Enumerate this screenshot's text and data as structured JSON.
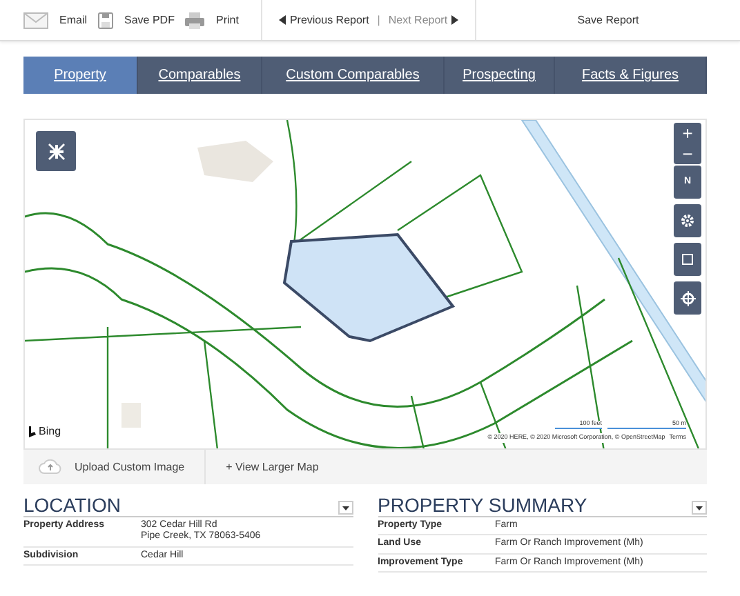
{
  "toolbar": {
    "actions": [
      {
        "label": "Email",
        "kind": "email"
      },
      {
        "label": "Save PDF",
        "kind": "pdf"
      },
      {
        "label": "Print",
        "kind": "print"
      }
    ],
    "previous": {
      "label": "Previous Report",
      "disabled": false
    },
    "next": {
      "label": "Next Report",
      "disabled": true
    },
    "separator": "|",
    "save": "Save Report"
  },
  "tabs": [
    {
      "label": "Property",
      "selected": true
    },
    {
      "label": "Comparables",
      "selected": false
    },
    {
      "label": "Custom Comparables",
      "selected": false
    },
    {
      "label": "Prospecting",
      "selected": false
    },
    {
      "label": "Facts & Figures",
      "selected": false
    }
  ],
  "map": {
    "kind": "picture",
    "controls": [
      {
        "kind": "zoom-in",
        "label": "+"
      },
      {
        "kind": "zoom-out",
        "label": "−"
      },
      {
        "kind": "compass",
        "label": "N"
      },
      {
        "kind": "settings"
      },
      {
        "kind": "select"
      },
      {
        "kind": "locate"
      }
    ],
    "brand": "Bing",
    "scale_feet": "100 feet",
    "scale_meters": "50 m",
    "attribution": "© 2020 HERE, © 2020 Microsoft Corporation, © OpenStreetMap",
    "terms": "Terms",
    "upload": "Upload Custom Image",
    "larger": "+ View Larger Map"
  },
  "sections": [
    {
      "title": "LOCATION",
      "rows": [
        {
          "label": "Property Address",
          "value": [
            "302 Cedar Hill Rd",
            "Pipe Creek, TX 78063-5406"
          ]
        },
        {
          "label": "Subdivision",
          "value": [
            "Cedar Hill"
          ]
        }
      ]
    },
    {
      "title": "PROPERTY SUMMARY",
      "rows": [
        {
          "label": "Property Type",
          "value": [
            "Farm"
          ]
        },
        {
          "label": "Land Use",
          "value": [
            "Farm Or Ranch Improvement (Mh)"
          ]
        },
        {
          "label": "Improvement Type",
          "value": [
            "Farm Or Ranch Improvement (Mh)"
          ]
        }
      ]
    }
  ]
}
